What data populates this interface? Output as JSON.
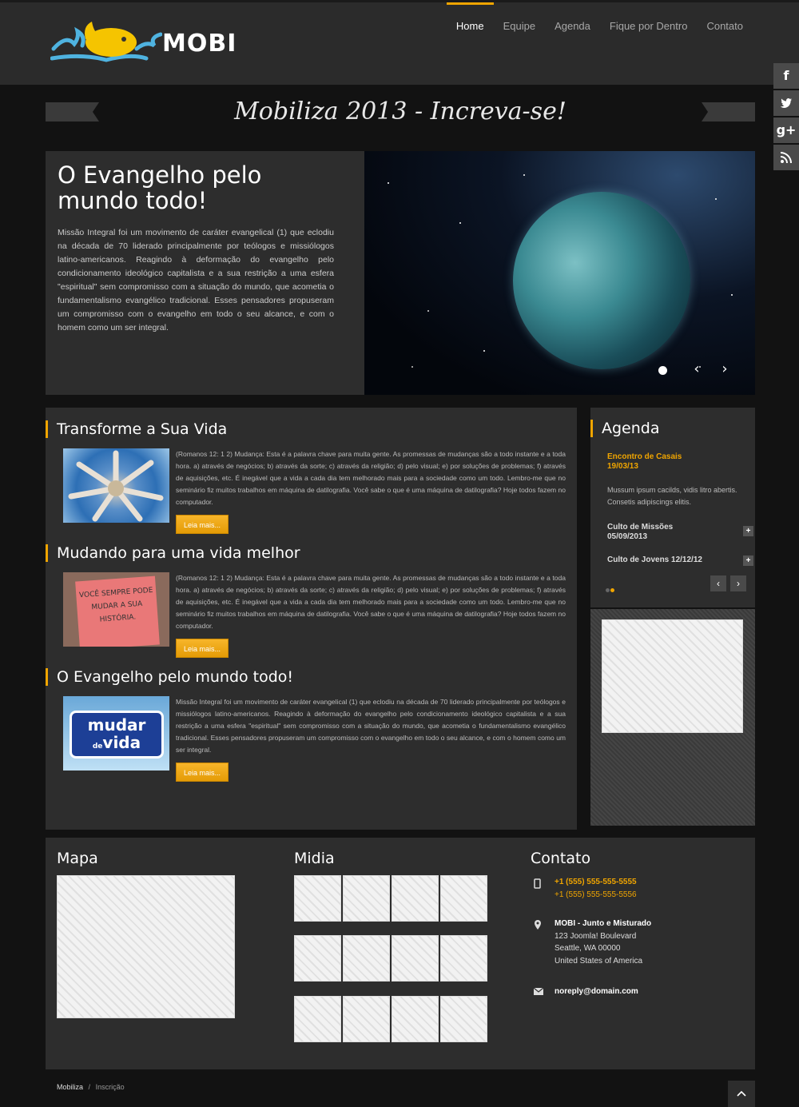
{
  "brand": {
    "name": "MOBI"
  },
  "nav": {
    "items": [
      "Home",
      "Equipe",
      "Agenda",
      "Fique por Dentro",
      "Contato"
    ],
    "active": "Home"
  },
  "social": {
    "icons": [
      "facebook-icon",
      "twitter-icon",
      "google-plus-icon",
      "rss-icon"
    ],
    "glyphs": [
      "f",
      "t",
      "g+",
      "rss"
    ]
  },
  "banner": {
    "title": "Mobiliza 2013 - Increva-se!"
  },
  "hero": {
    "title": "O Evangelho pelo mundo todo!",
    "text": "Missão Integral foi um movimento de caráter evangelical (1) que eclodiu na década de 70 liderado principalmente por teólogos e missiólogos latino-americanos. Reagindo à deformação do evangelho pelo condicionamento ideológico capitalista e a sua restrição a uma esfera \"espiritual\" sem compromisso com a situação do mundo, que acometia o fundamentalismo evangélico tradicional. Esses pensadores propuseram um compromisso com o evangelho em todo o seu alcance, e com o homem como um ser integral."
  },
  "articles": [
    {
      "title": "Transforme a Sua Vida",
      "text": "(Romanos 12: 1 2) Mudança: Esta é a palavra chave para muita gente.  As promessas de mudanças são a todo instante e a toda hora.  a) através de negócios;  b) através da sorte;  c) através da religião;  d) pelo visual;  e) por soluções de problemas;  f) através de aquisições, etc. É inegável que a vida a cada dia tem melhorado mais para a sociedade como um todo. Lembro-me que no seminário fiz muitos trabalhos em máquina de datilografia. Você sabe o que é uma máquina de datilografia? Hoje todos fazem no computador.",
      "button": "Leia mais..."
    },
    {
      "title": "Mudando para uma vida melhor",
      "text": "(Romanos 12: 1 2) Mudança: Esta é a palavra chave para muita gente.  As promessas de mudanças são a todo instante e a toda hora.  a) através de negócios;  b) através da sorte;  c) através da religião;  d) pelo visual;  e) por soluções de problemas;  f) através de aquisições, etc. É inegável que a vida a cada dia tem melhorado mais para a sociedade como um todo. Lembro-me que no seminário fiz muitos trabalhos em máquina de datilografia. Você sabe o que é uma máquina de datilografia? Hoje todos fazem no computador.",
      "button": "Leia mais...",
      "image_text": "VOCÊ SEMPRE PODE MUDAR A SUA HISTÓRIA."
    },
    {
      "title": "O Evangelho pelo mundo todo!",
      "text": "Missão Integral foi um movimento de caráter evangelical (1) que eclodiu na década de 70 liderado principalmente por teólogos e missiólogos latino-americanos. Reagindo à deformação do evangelho pelo condicionamento ideológico capitalista e a sua restrição a uma esfera \"espiritual\" sem compromisso com a situação do mundo, que acometia o fundamentalismo evangélico tradicional. Esses pensadores propuseram um compromisso com o evangelho em todo o seu alcance, e com o homem como um ser integral.",
      "button": "Leia mais...",
      "image_text_1": "mudar",
      "image_text_2": "de",
      "image_text_3": "vida"
    }
  ],
  "agenda": {
    "title": "Agenda",
    "featured_title": "Encontro de Casais",
    "featured_date": "19/03/13",
    "featured_desc": "Mussum ipsum cacilds, vidis litro abertis. Consetis adipiscings elitis.",
    "events": [
      {
        "label": "Culto de Missões",
        "date": "05/09/2013"
      },
      {
        "label": "Culto de Jovens 12/12/12"
      }
    ],
    "prev": "‹",
    "next": "›",
    "expand": "+"
  },
  "footer": {
    "mapa": {
      "title": "Mapa"
    },
    "midia": {
      "title": "Midia"
    },
    "contato": {
      "title": "Contato",
      "phone1": "+1 (555) 555-555-5555",
      "phone2": "+1 (555) 555-555-5556",
      "name": "MOBI - Junto e Misturado",
      "address1": "123 Joomla! Boulevard",
      "address2": "Seattle, WA 00000",
      "address3": "United States of America",
      "email": "noreply@domain.com"
    }
  },
  "breadcrumb": {
    "home": "Mobiliza",
    "separator": "/",
    "current": "Inscrição"
  },
  "colors": {
    "accent": "#f0a500",
    "panel": "#2d2d2d",
    "background": "#121212"
  }
}
